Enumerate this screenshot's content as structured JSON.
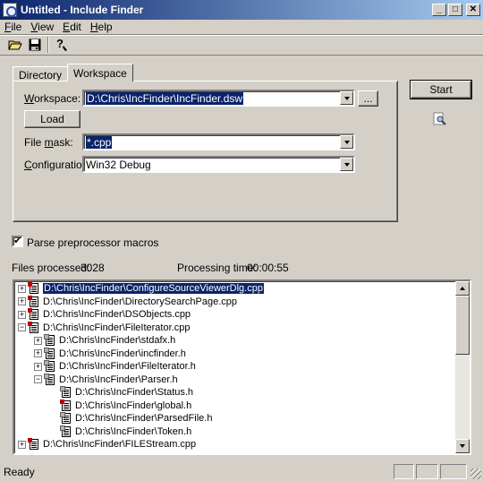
{
  "window": {
    "title": "Untitled - Include Finder"
  },
  "menu": {
    "items": [
      {
        "u": "F",
        "rest": "ile"
      },
      {
        "u": "V",
        "rest": "iew"
      },
      {
        "u": "E",
        "rest": "dit"
      },
      {
        "u": "H",
        "rest": "elp"
      }
    ]
  },
  "toolbar": {
    "icons": [
      "open-folder-icon",
      "save-icon",
      "help-icon"
    ]
  },
  "tabs": {
    "directory": "Directory",
    "workspace": "Workspace"
  },
  "workspace": {
    "label_u": "W",
    "label_rest": "orkspace:",
    "value": "D:\\Chris\\IncFinder\\IncFinder.dsw",
    "browse_label": "...",
    "load_label": "Load",
    "filemask_pre": "File ",
    "filemask_u": "m",
    "filemask_rest": "ask:",
    "filemask_value": "*.cpp",
    "config_u": "C",
    "config_rest": "onfiguration:",
    "config_value": "Win32 Debug"
  },
  "start_label": "Start",
  "parse_label": "Parse preprocessor macros",
  "parse_checked": "✔",
  "stats": {
    "files_label": "Files processed:",
    "files_value": "3028",
    "time_label": "Processing time:",
    "time_value": "00:00:55"
  },
  "tree": [
    {
      "text": "D:\\Chris\\IncFinder\\ConfigureSourceViewerDlg.cpp",
      "expander": "+",
      "icon": "cpp",
      "selected": true
    },
    {
      "text": "D:\\Chris\\IncFinder\\DirectorySearchPage.cpp",
      "expander": "+",
      "icon": "cpp"
    },
    {
      "text": "D:\\Chris\\IncFinder\\DSObjects.cpp",
      "expander": "+",
      "icon": "cpp"
    },
    {
      "text": "D:\\Chris\\IncFinder\\FileIterator.cpp",
      "expander": "−",
      "icon": "cpp"
    },
    {
      "text": "D:\\Chris\\IncFinder\\stdafx.h",
      "expander": "+",
      "icon": "h"
    },
    {
      "text": "D:\\Chris\\IncFinder\\incfinder.h",
      "expander": "+",
      "icon": "h"
    },
    {
      "text": "D:\\Chris\\IncFinder\\FileIterator.h",
      "expander": "+",
      "icon": "h"
    },
    {
      "text": "D:\\Chris\\IncFinder\\Parser.h",
      "expander": "−",
      "icon": "h"
    },
    {
      "text": "D:\\Chris\\IncFinder\\Status.h",
      "expander": "",
      "icon": "h"
    },
    {
      "text": "D:\\Chris\\IncFinder\\global.h",
      "expander": "",
      "icon": "hr"
    },
    {
      "text": "D:\\Chris\\IncFinder\\ParsedFile.h",
      "expander": "",
      "icon": "h"
    },
    {
      "text": "D:\\Chris\\IncFinder\\Token.h",
      "expander": "",
      "icon": "h"
    },
    {
      "text": "D:\\Chris\\IncFinder\\FILEStream.cpp",
      "expander": "+",
      "icon": "cpp"
    }
  ],
  "status": {
    "text": "Ready"
  },
  "colors": {
    "title_start": "#0a246a",
    "title_end": "#a6caf0",
    "selection": "#0a246a",
    "face": "#d4d0c8"
  }
}
